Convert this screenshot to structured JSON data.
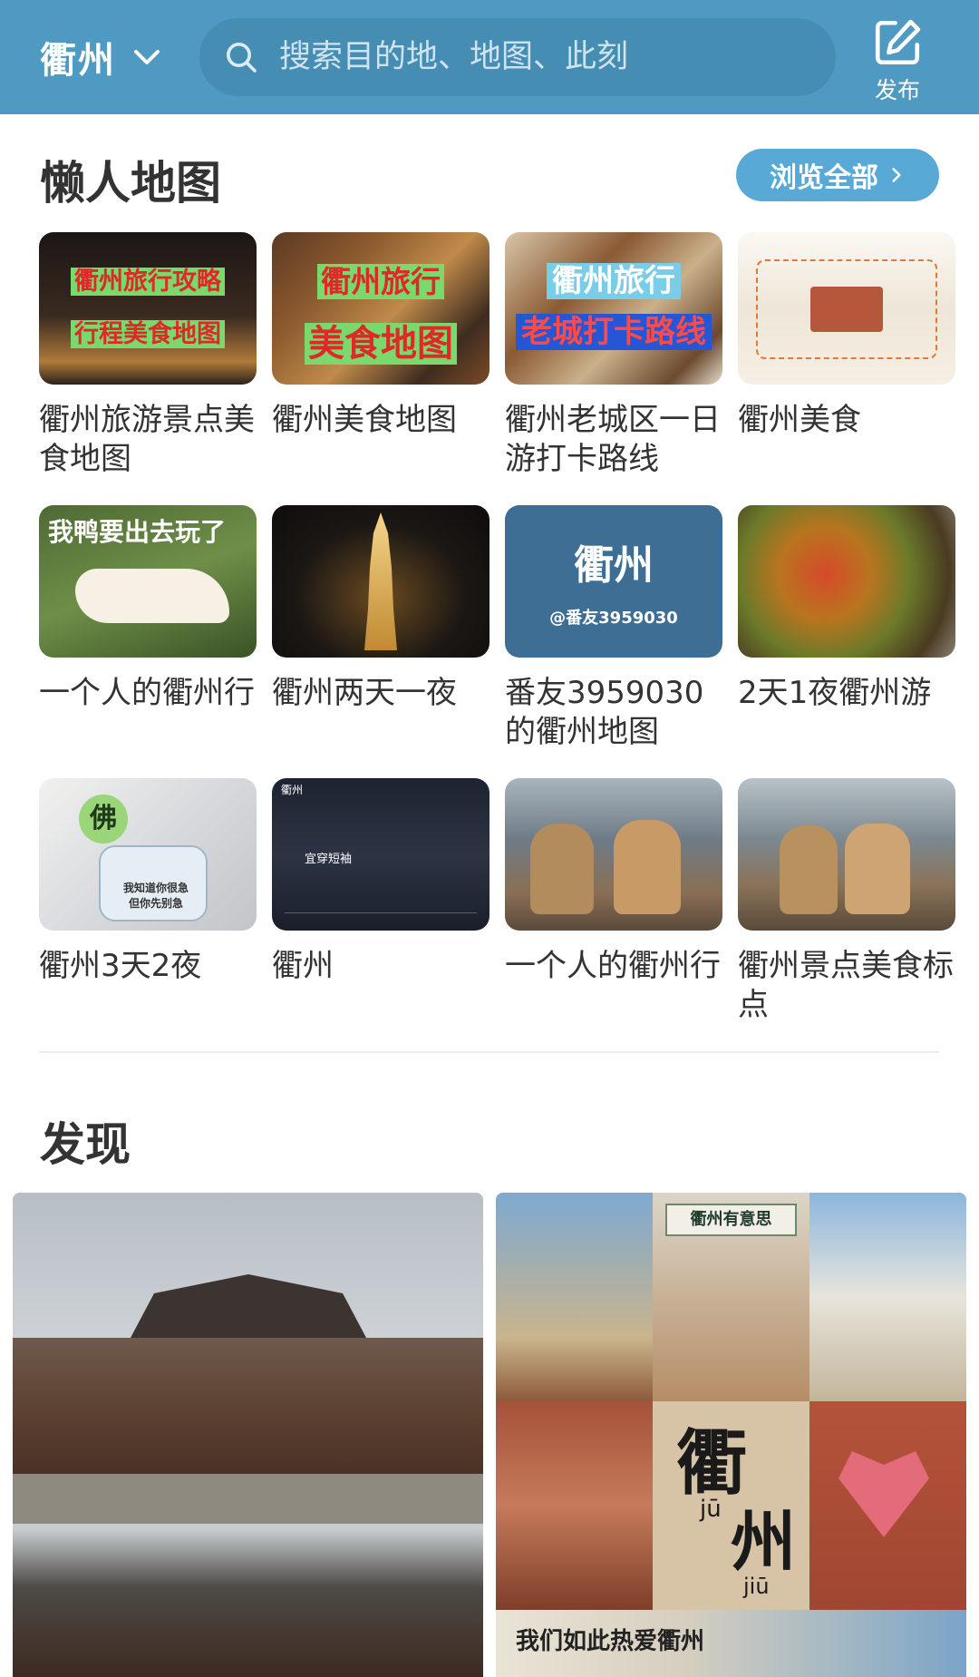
{
  "header": {
    "city": "衢州",
    "search_placeholder": "搜索目的地、地图、此刻",
    "publish_label": "发布",
    "brand_color": "#4f9ac3"
  },
  "lazy_maps": {
    "title": "懒人地图",
    "browse_all_label": "浏览全部",
    "items": [
      {
        "title": "衢州旅游景点美食地图",
        "thumb_lines": [
          "衢州旅行攻略",
          "行程美食地图"
        ]
      },
      {
        "title": "衢州美食地图",
        "thumb_lines": [
          "衢州旅行",
          "美食地图"
        ]
      },
      {
        "title": "衢州老城区一日游打卡路线",
        "thumb_lines": [
          "衢州旅行",
          "老城打卡路线"
        ]
      },
      {
        "title": "衢州美食",
        "thumb_lines": []
      },
      {
        "title": "一个人的衢州行",
        "thumb_lines": [
          "我鸭要出去玩了"
        ]
      },
      {
        "title": "衢州两天一夜",
        "thumb_lines": []
      },
      {
        "title": "番友3959030的衢州地图",
        "thumb_lines": [
          "衢州",
          "@番友3959030"
        ]
      },
      {
        "title": "2天1夜衢州游",
        "thumb_lines": []
      },
      {
        "title": "衢州3天2夜",
        "thumb_lines": [
          "佛",
          "我知道你很急",
          "但你先别急"
        ]
      },
      {
        "title": "衢州",
        "thumb_lines": [
          "衢州",
          "宜穿短袖"
        ]
      },
      {
        "title": "一个人的衢州行",
        "thumb_lines": []
      },
      {
        "title": "衢州景点美食标点",
        "thumb_lines": []
      }
    ]
  },
  "discover": {
    "title": "发现",
    "right_card_text": [
      "衢州有意思",
      "衢",
      "州",
      "jū",
      "jiū",
      "我们如此热爱衢州"
    ]
  }
}
